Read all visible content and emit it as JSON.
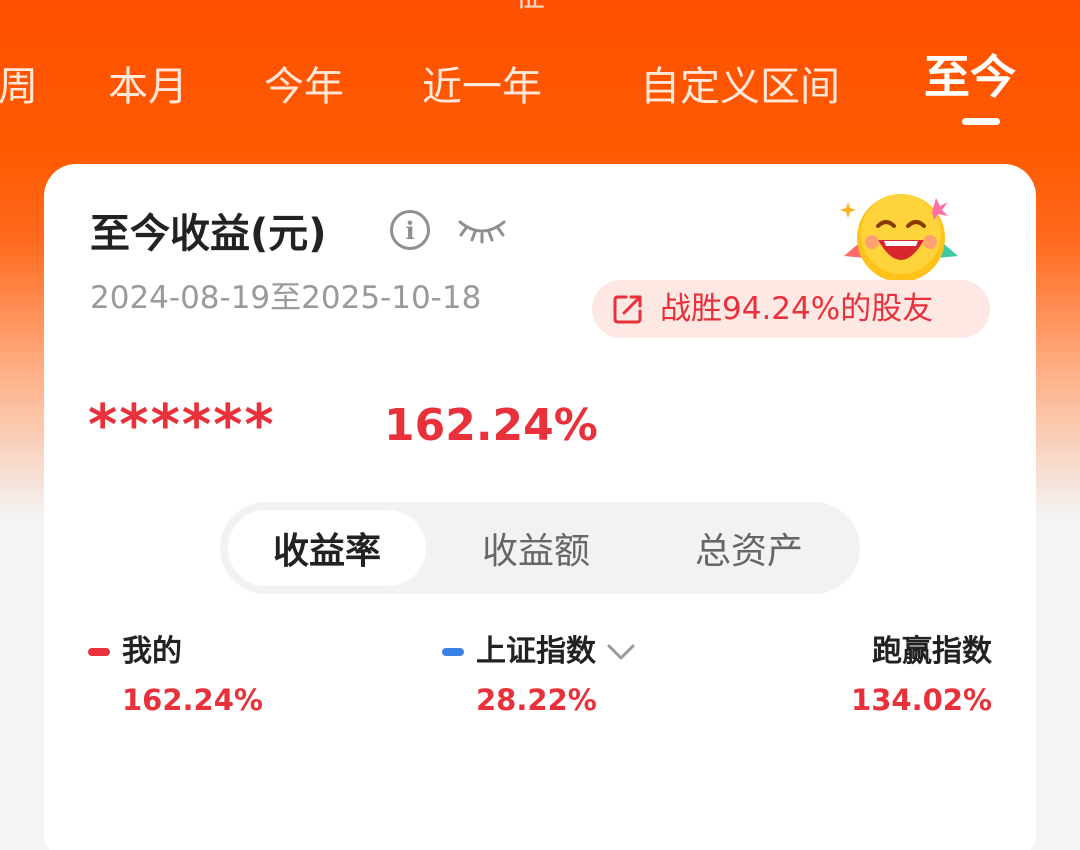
{
  "header": {
    "top_fragment": "征",
    "period_tabs": [
      {
        "label": "周"
      },
      {
        "label": "本月"
      },
      {
        "label": "今年"
      },
      {
        "label": "近一年"
      },
      {
        "label": "自定义区间"
      },
      {
        "label": "至今",
        "active": true
      }
    ]
  },
  "summary": {
    "title": "至今收益(元)",
    "info_icon": "info-icon",
    "visibility_icon": "eye-closed-icon",
    "date_range": "2024-08-19至2025-10-18",
    "mascot_icon": "laughing-emoji-icon",
    "beat_badge": {
      "icon": "share-icon",
      "text": "战胜94.24%的股友"
    },
    "amount_masked": "******",
    "return_rate": "162.24%"
  },
  "metric_tabs": [
    {
      "label": "收益率",
      "active": true
    },
    {
      "label": "收益额"
    },
    {
      "label": "总资产"
    }
  ],
  "comparison": {
    "mine": {
      "label": "我的",
      "value": "162.24%",
      "color": "#E8313A"
    },
    "index": {
      "label": "上证指数",
      "value": "28.22%",
      "color": "#3B82E6",
      "dropdown_icon": "chevron-down-icon"
    },
    "outperform": {
      "label": "跑赢指数",
      "value": "134.02%"
    }
  },
  "colors": {
    "brand_orange": "#FF5000",
    "gain_red": "#E8313A",
    "index_blue": "#3B82E6"
  }
}
